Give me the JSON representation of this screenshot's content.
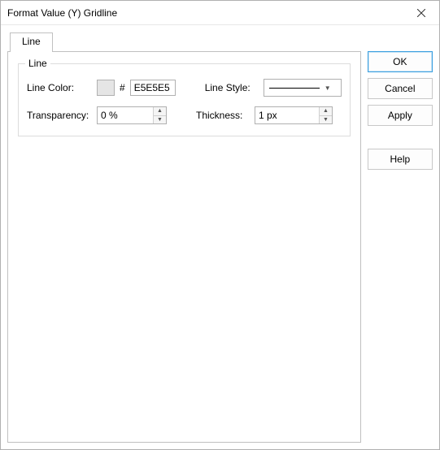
{
  "window": {
    "title": "Format Value (Y) Gridline"
  },
  "tabs": {
    "line_label": "Line"
  },
  "group": {
    "legend": "Line",
    "line_color_label": "Line Color:",
    "hex_prefix": "#",
    "hex_value": "E5E5E5",
    "swatch_color": "#E5E5E5",
    "line_style_label": "Line Style:",
    "transparency_label": "Transparency:",
    "transparency_value": "0 %",
    "thickness_label": "Thickness:",
    "thickness_value": "1 px"
  },
  "buttons": {
    "ok": "OK",
    "cancel": "Cancel",
    "apply": "Apply",
    "help": "Help"
  }
}
